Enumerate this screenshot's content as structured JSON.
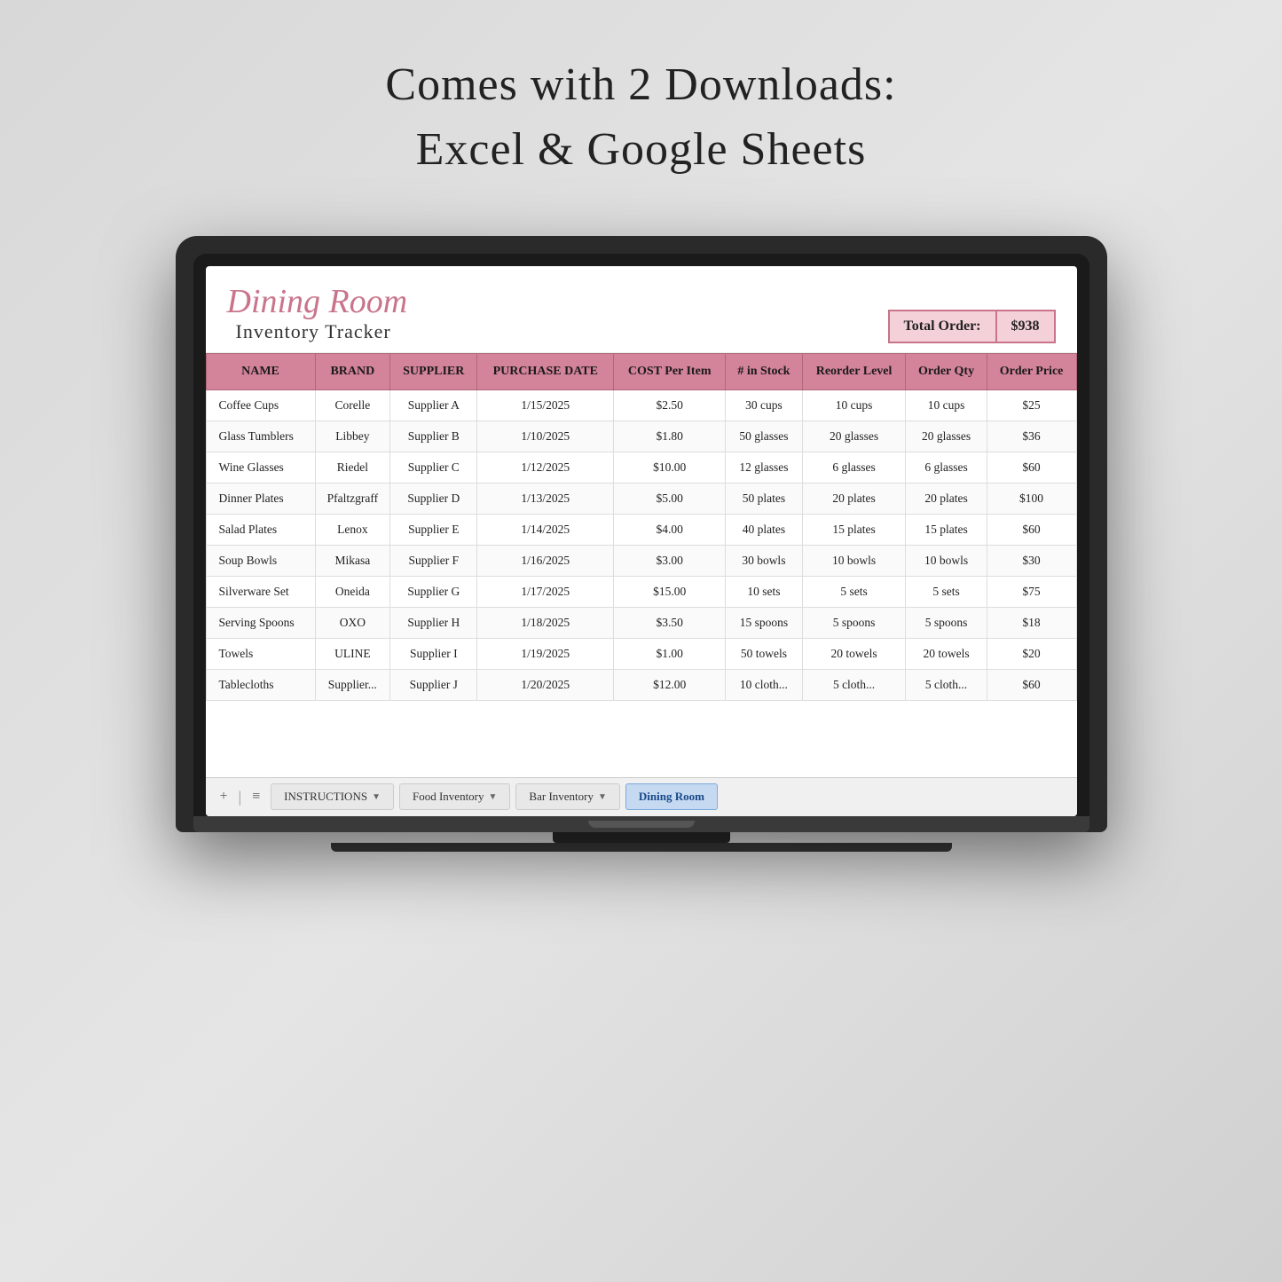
{
  "headline": {
    "line1": "Comes with 2 Downloads:",
    "line2": "Excel & Google Sheets"
  },
  "spreadsheet": {
    "title_cursive": "Dining Room",
    "title_plain": "Inventory Tracker",
    "total_order_label": "Total Order:",
    "total_order_value": "$938",
    "columns": [
      "NAME",
      "BRAND",
      "SUPPLIER",
      "PURCHASE DATE",
      "COST Per Item",
      "# in Stock",
      "Reorder Level",
      "Order Qty",
      "Order Price"
    ],
    "rows": [
      [
        "Coffee Cups",
        "Corelle",
        "Supplier A",
        "1/15/2025",
        "$2.50",
        "30 cups",
        "10 cups",
        "10 cups",
        "$25"
      ],
      [
        "Glass Tumblers",
        "Libbey",
        "Supplier B",
        "1/10/2025",
        "$1.80",
        "50 glasses",
        "20 glasses",
        "20 glasses",
        "$36"
      ],
      [
        "Wine Glasses",
        "Riedel",
        "Supplier C",
        "1/12/2025",
        "$10.00",
        "12 glasses",
        "6 glasses",
        "6 glasses",
        "$60"
      ],
      [
        "Dinner Plates",
        "Pfaltzgraff",
        "Supplier D",
        "1/13/2025",
        "$5.00",
        "50 plates",
        "20 plates",
        "20 plates",
        "$100"
      ],
      [
        "Salad Plates",
        "Lenox",
        "Supplier E",
        "1/14/2025",
        "$4.00",
        "40 plates",
        "15 plates",
        "15 plates",
        "$60"
      ],
      [
        "Soup Bowls",
        "Mikasa",
        "Supplier F",
        "1/16/2025",
        "$3.00",
        "30 bowls",
        "10 bowls",
        "10 bowls",
        "$30"
      ],
      [
        "Silverware Set",
        "Oneida",
        "Supplier G",
        "1/17/2025",
        "$15.00",
        "10 sets",
        "5 sets",
        "5 sets",
        "$75"
      ],
      [
        "Serving Spoons",
        "OXO",
        "Supplier H",
        "1/18/2025",
        "$3.50",
        "15 spoons",
        "5 spoons",
        "5 spoons",
        "$18"
      ],
      [
        "Towels",
        "ULINE",
        "Supplier I",
        "1/19/2025",
        "$1.00",
        "50 towels",
        "20 towels",
        "20 towels",
        "$20"
      ],
      [
        "Tablecloths",
        "Supplier...",
        "Supplier J",
        "1/20/2025",
        "$12.00",
        "10 cloth...",
        "5 cloth...",
        "5 cloth...",
        "$60"
      ]
    ]
  },
  "tabs": {
    "add_icon": "+",
    "menu_icon": "≡",
    "items": [
      {
        "label": "INSTRUCTIONS",
        "active": false,
        "has_dropdown": true
      },
      {
        "label": "Food Inventory",
        "active": false,
        "has_dropdown": true
      },
      {
        "label": "Bar Inventory",
        "active": false,
        "has_dropdown": true
      },
      {
        "label": "Dining Room",
        "active": true,
        "has_dropdown": false
      }
    ]
  }
}
